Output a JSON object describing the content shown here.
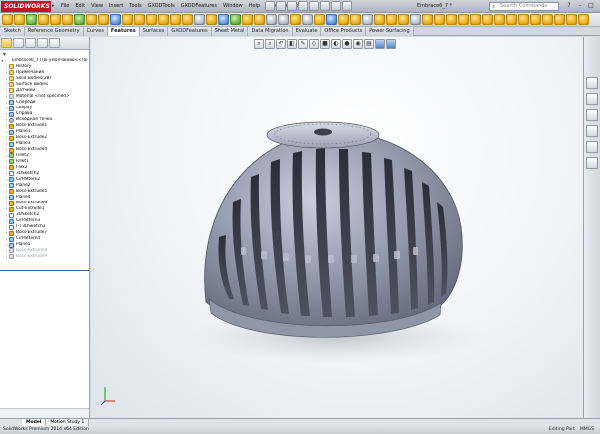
{
  "app": {
    "logo_text": "SOLIDWORKS",
    "document_title": "Embrace6_7 *",
    "menu": [
      "File",
      "Edit",
      "View",
      "Insert",
      "Tools",
      "GXODTools",
      "GXODFeatures",
      "Window",
      "Help",
      "Power Surfacing"
    ],
    "search_placeholder": "Search Commands"
  },
  "command_tabs": [
    "Sketch",
    "Reference Geometry",
    "Curves",
    "Features",
    "Surfaces",
    "GXODFeatures",
    "Sheet Metal",
    "Data Migration",
    "Evaluate",
    "Office Products",
    "Power Surfacing"
  ],
  "active_command_tab": "Features",
  "tree": {
    "items": [
      {
        "label": "Embrace6_7 (По умолчанию<<По умо",
        "icon": "part",
        "indent": 0
      },
      {
        "label": "History",
        "icon": "folder",
        "indent": 1
      },
      {
        "label": "Примечания",
        "icon": "folder",
        "indent": 1
      },
      {
        "label": "Solid Bodies(28)",
        "icon": "folder",
        "indent": 1
      },
      {
        "label": "Surface Bodies",
        "icon": "folder",
        "indent": 1
      },
      {
        "label": "Датчики",
        "icon": "folder",
        "indent": 1
      },
      {
        "label": "Material <not specified>",
        "icon": "gray",
        "indent": 1
      },
      {
        "label": "Спереди",
        "icon": "plane",
        "indent": 1
      },
      {
        "label": "Сверху",
        "icon": "plane",
        "indent": 1
      },
      {
        "label": "Справа",
        "icon": "plane",
        "indent": 1
      },
      {
        "label": "Исходная точка",
        "icon": "origin",
        "indent": 1
      },
      {
        "label": "Boss-Extrude1",
        "icon": "feat",
        "indent": 1
      },
      {
        "label": "Plane1",
        "icon": "plane",
        "indent": 1
      },
      {
        "label": "Boss-Extrude2",
        "icon": "feat",
        "indent": 1
      },
      {
        "label": "Plane3",
        "icon": "plane",
        "indent": 1
      },
      {
        "label": "Boss-Extrude4",
        "icon": "feat",
        "indent": 1
      },
      {
        "label": "Fillet2",
        "icon": "fillet",
        "indent": 1
      },
      {
        "label": "Fillet1",
        "icon": "fillet",
        "indent": 1
      },
      {
        "label": "Flex2",
        "icon": "feat",
        "indent": 1
      },
      {
        "label": "3DSketch2",
        "icon": "sketch",
        "indent": 1
      },
      {
        "label": "CirPattern2",
        "icon": "pattern",
        "indent": 1
      },
      {
        "label": "Plane2",
        "icon": "plane",
        "indent": 1
      },
      {
        "label": "Boss-Extrude5",
        "icon": "feat",
        "indent": 1
      },
      {
        "label": "Plane4",
        "icon": "plane",
        "indent": 1
      },
      {
        "label": "Boss-Extrude6",
        "icon": "feat",
        "indent": 1
      },
      {
        "label": "Cut-Extrude1",
        "icon": "feat",
        "indent": 1
      },
      {
        "label": "3DSketch2",
        "icon": "sketch",
        "indent": 1
      },
      {
        "label": "CirPattern3",
        "icon": "pattern",
        "indent": 1
      },
      {
        "label": "(-) 3DSketch3",
        "icon": "sketch",
        "indent": 1
      },
      {
        "label": "Boss-Extrude7",
        "icon": "feat",
        "indent": 1
      },
      {
        "label": "CirPattern4",
        "icon": "pattern",
        "indent": 1
      },
      {
        "label": "Plane5",
        "icon": "plane",
        "indent": 1
      },
      {
        "label": "Boss-Extrude8",
        "icon": "gray",
        "indent": 1,
        "dim": true
      },
      {
        "label": "Boss-Extrude9",
        "icon": "gray",
        "indent": 1,
        "dim": true
      }
    ]
  },
  "bottom_tabs": [
    "Model",
    "Motion Study 1"
  ],
  "active_bottom_tab": "Model",
  "status": {
    "left": "SolidWorks Premium 2014 x64 Edition",
    "right": [
      "Editing Part",
      "MMGS"
    ]
  },
  "colors": {
    "accent": "#c8102e",
    "model": "#8c93a6"
  }
}
